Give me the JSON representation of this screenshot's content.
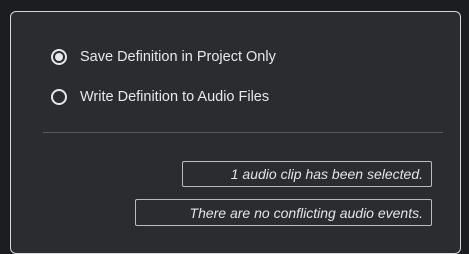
{
  "options": {
    "save_in_project": {
      "label": "Save Definition in Project Only",
      "checked": true
    },
    "write_to_files": {
      "label": "Write Definition to Audio Files",
      "checked": false
    }
  },
  "status": {
    "selection": "1 audio clip has been selected.",
    "conflicts": "There are no conflicting audio events."
  }
}
